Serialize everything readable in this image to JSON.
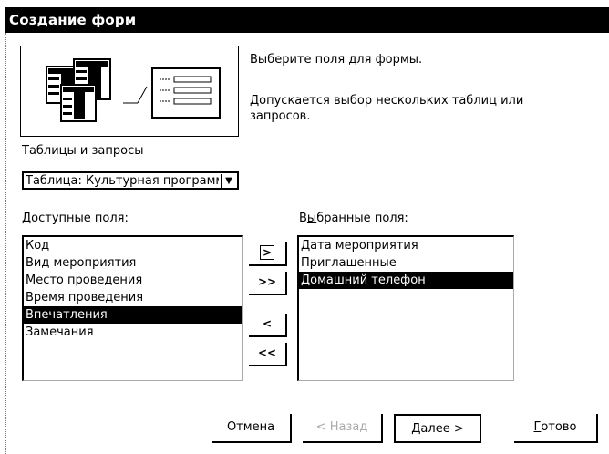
{
  "window": {
    "title": "Создание форм"
  },
  "intro": {
    "line1": "Выберите поля для формы.",
    "line2": "Допускается выбор нескольких таблиц или запросов."
  },
  "source": {
    "label": "Таблицы и запросы",
    "selected": "Таблица: Культурная программа"
  },
  "available": {
    "label": "Доступные поля:",
    "items": [
      "Код",
      "Вид мероприятия",
      "Место проведения",
      "Время проведения",
      "Впечатления",
      "Замечания"
    ],
    "selected_index": 4
  },
  "chosen": {
    "label": "Выбранные поля:",
    "items": [
      "Дата мероприятия",
      "Приглашенные",
      "Домашний телефон"
    ],
    "selected_index": 2
  },
  "move_buttons": {
    "add_one": ">",
    "add_all": ">>",
    "remove_one": "<",
    "remove_all": "<<"
  },
  "footer": {
    "cancel": "Отмена",
    "back": "< Назад",
    "next": "Далее >",
    "finish": "Готово"
  }
}
